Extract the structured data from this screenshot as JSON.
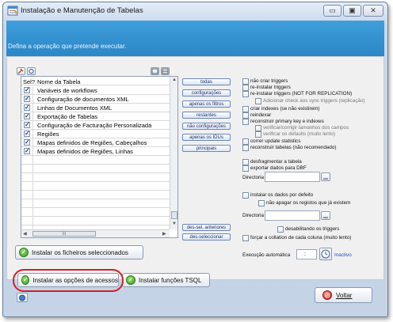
{
  "window": {
    "title": "Instalação e Manutenção de Tabelas",
    "minimize_glyph": "▭",
    "maximize_glyph": "▣",
    "close_glyph": "✕"
  },
  "header": {
    "text": "Defina a operação que pretende executar."
  },
  "grid": {
    "col_sel": "Sel?",
    "col_name": "Nome da Tabela",
    "rows": [
      {
        "checked": true,
        "name": "Variáveis de workflows"
      },
      {
        "checked": true,
        "name": "Configuração de documentos XML"
      },
      {
        "checked": true,
        "name": "Linhas de Documentos XML"
      },
      {
        "checked": true,
        "name": "Exportação de Tabelas"
      },
      {
        "checked": true,
        "name": "Configuração de Facturação Personalizada"
      },
      {
        "checked": true,
        "name": "Regiões"
      },
      {
        "checked": true,
        "name": "Mapas definidos de Regiões, Cabeçalhos"
      },
      {
        "checked": true,
        "name": "Mapas definidos de Regiões, Linhas"
      }
    ],
    "hscroll_thumb": "III"
  },
  "select_buttons": [
    "todas",
    "configurações",
    "apenas os filtros",
    "restantes",
    "não configurações",
    "apenas os IDUs",
    "principais"
  ],
  "deselect_buttons": [
    "des-sel. anteriores",
    "des-seleccionar"
  ],
  "options": {
    "nao_criar_triggers": "não criar triggers",
    "reinstalar_triggers": "re-instalar triggers",
    "reinstalar_triggers_nfr": "re-instalar triggers (NOT FOR REPLICATION)",
    "adicionar_check": "Adicionar check aos sync triggers (replicação)",
    "criar_indexes": "criar indexes (se não existirem)",
    "reindexar": "reindexar",
    "reconstruir_pk": "reconstruir primary key e indexes",
    "verificar_tamanhos": "verificar/corrigir tamanhos dos campos",
    "verificar_defaults": "verificar os defaults (muito lento)",
    "correr_update": "correr update statistics",
    "reconstruir_tabelas": "reconstruir tabelas (não recomendado)",
    "desfragmentar": "desfragmentar a tabela",
    "exportar_dbf": "exportar dados para DBF",
    "directoria1": "Directoria",
    "instalar_dados": "instalar os dados por defeito",
    "nao_apagar": "não apagar os registos que já existem",
    "directoria2": "Directoria",
    "desabilitando": "desabilitando os triggers",
    "forcar_collation": "forçar a collation de cada coluna (muito lento)",
    "execucao_label": "Execução automática",
    "execucao_value": ":",
    "execucao_status": "Inactivo"
  },
  "buttons": {
    "instalar_ficheiros": "Instalar os ficheiros seleccionados",
    "instalar_acessos": "Instalar as opções de acessos",
    "instalar_tsql": "Instalar funções TSQL",
    "voltar": "Voltar"
  },
  "colors": {
    "header_blue": "#2b86c6",
    "highlight_red": "#d0202a",
    "inactive_link": "#1f4fc7"
  }
}
